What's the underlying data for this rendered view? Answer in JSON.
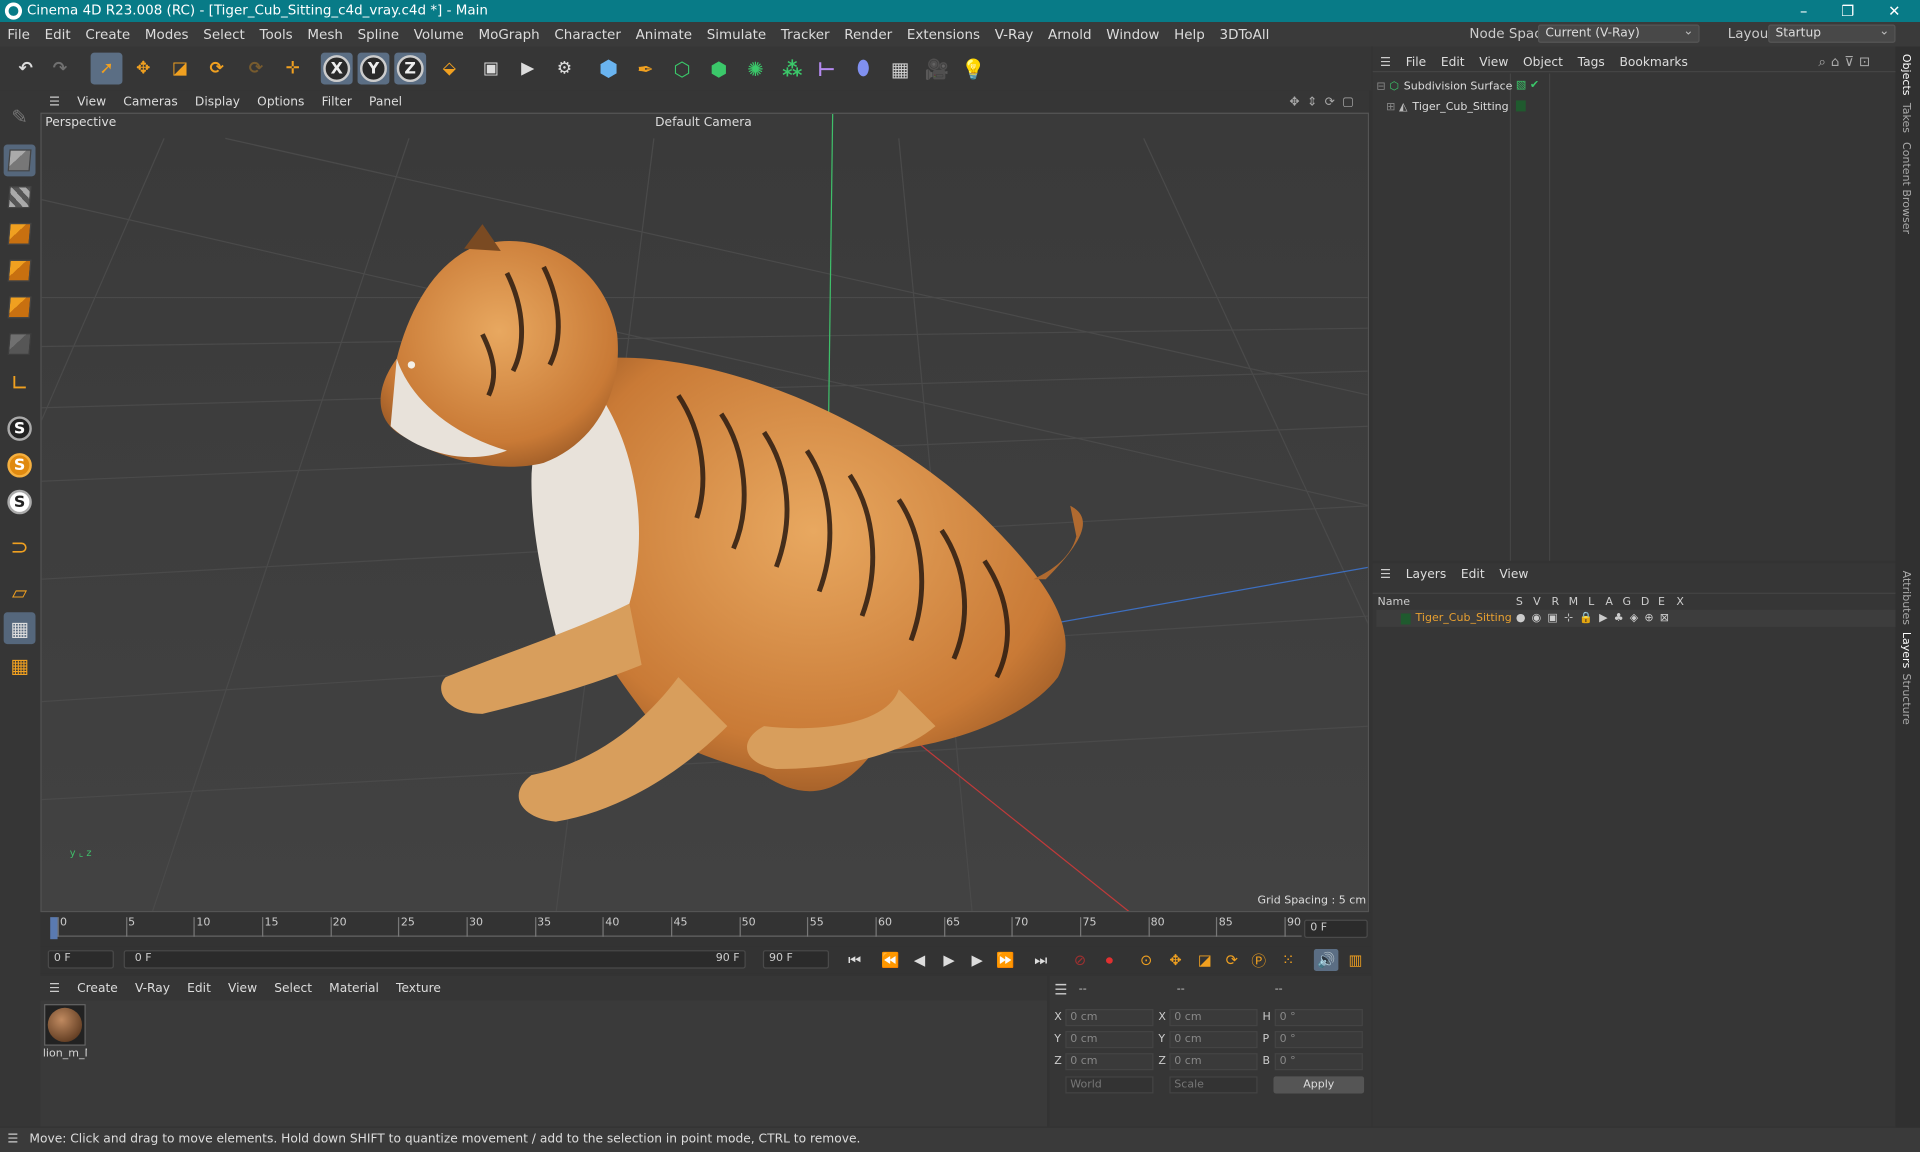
{
  "title": "Cinema 4D R23.008 (RC) - [Tiger_Cub_Sitting_c4d_vray.c4d *] - Main",
  "menu": [
    "File",
    "Edit",
    "Create",
    "Modes",
    "Select",
    "Tools",
    "Mesh",
    "Spline",
    "Volume",
    "MoGraph",
    "Character",
    "Animate",
    "Simulate",
    "Tracker",
    "Render",
    "Extensions",
    "V-Ray",
    "Arnold",
    "Window",
    "Help",
    "3DToAll"
  ],
  "node_space_label": "Node Space:",
  "node_space_value": "Current (V-Ray)",
  "layout_label": "Layout:",
  "layout_value": "Startup",
  "viewport": {
    "menu": [
      "View",
      "Cameras",
      "Display",
      "Options",
      "Filter",
      "Panel"
    ],
    "name": "Perspective",
    "camera": "Default Camera",
    "grid_spacing": "Grid Spacing : 5 cm"
  },
  "timeline": {
    "ticks": [
      "0",
      "5",
      "10",
      "15",
      "20",
      "25",
      "30",
      "35",
      "40",
      "45",
      "50",
      "55",
      "60",
      "65",
      "70",
      "75",
      "80",
      "85",
      "90"
    ],
    "current_frame": "0 F",
    "start_field": "0 F",
    "range_start": "0 F",
    "range_end": "90 F",
    "end_field": "90 F"
  },
  "material_menu": [
    "Create",
    "V-Ray",
    "Edit",
    "View",
    "Select",
    "Material",
    "Texture"
  ],
  "material_name": "lion_m_M",
  "coords": {
    "headers": [
      "--",
      "--",
      "--"
    ],
    "rows": [
      {
        "a": "X",
        "av": "0 cm",
        "b": "X",
        "bv": "0 cm",
        "c": "H",
        "cv": "0 °"
      },
      {
        "a": "Y",
        "av": "0 cm",
        "b": "Y",
        "bv": "0 cm",
        "c": "P",
        "cv": "0 °"
      },
      {
        "a": "Z",
        "av": "0 cm",
        "b": "Z",
        "bv": "0 cm",
        "c": "B",
        "cv": "0 °"
      }
    ],
    "mode": "World",
    "scale": "Scale",
    "apply": "Apply"
  },
  "objects": {
    "menu": [
      "File",
      "Edit",
      "View",
      "Object",
      "Tags",
      "Bookmarks"
    ],
    "items": [
      "Subdivision Surface",
      "Tiger_Cub_Sitting"
    ]
  },
  "layers": {
    "menu": [
      "Layers",
      "Edit",
      "View"
    ],
    "name_header": "Name",
    "flags": [
      "S",
      "V",
      "R",
      "M",
      "L",
      "A",
      "G",
      "D",
      "E",
      "X"
    ],
    "layer_name": "Tiger_Cub_Sitting"
  },
  "side_tabs": [
    "Objects",
    "Takes",
    "Content Browser",
    "Attributes",
    "Layers",
    "Structure"
  ],
  "status": "Move: Click and drag to move elements. Hold down SHIFT to quantize movement / add to the selection in point mode, CTRL to remove.",
  "colors": {
    "titlebar": "#087b87",
    "accent": "#f0a020",
    "layer_text": "#e8a030"
  }
}
